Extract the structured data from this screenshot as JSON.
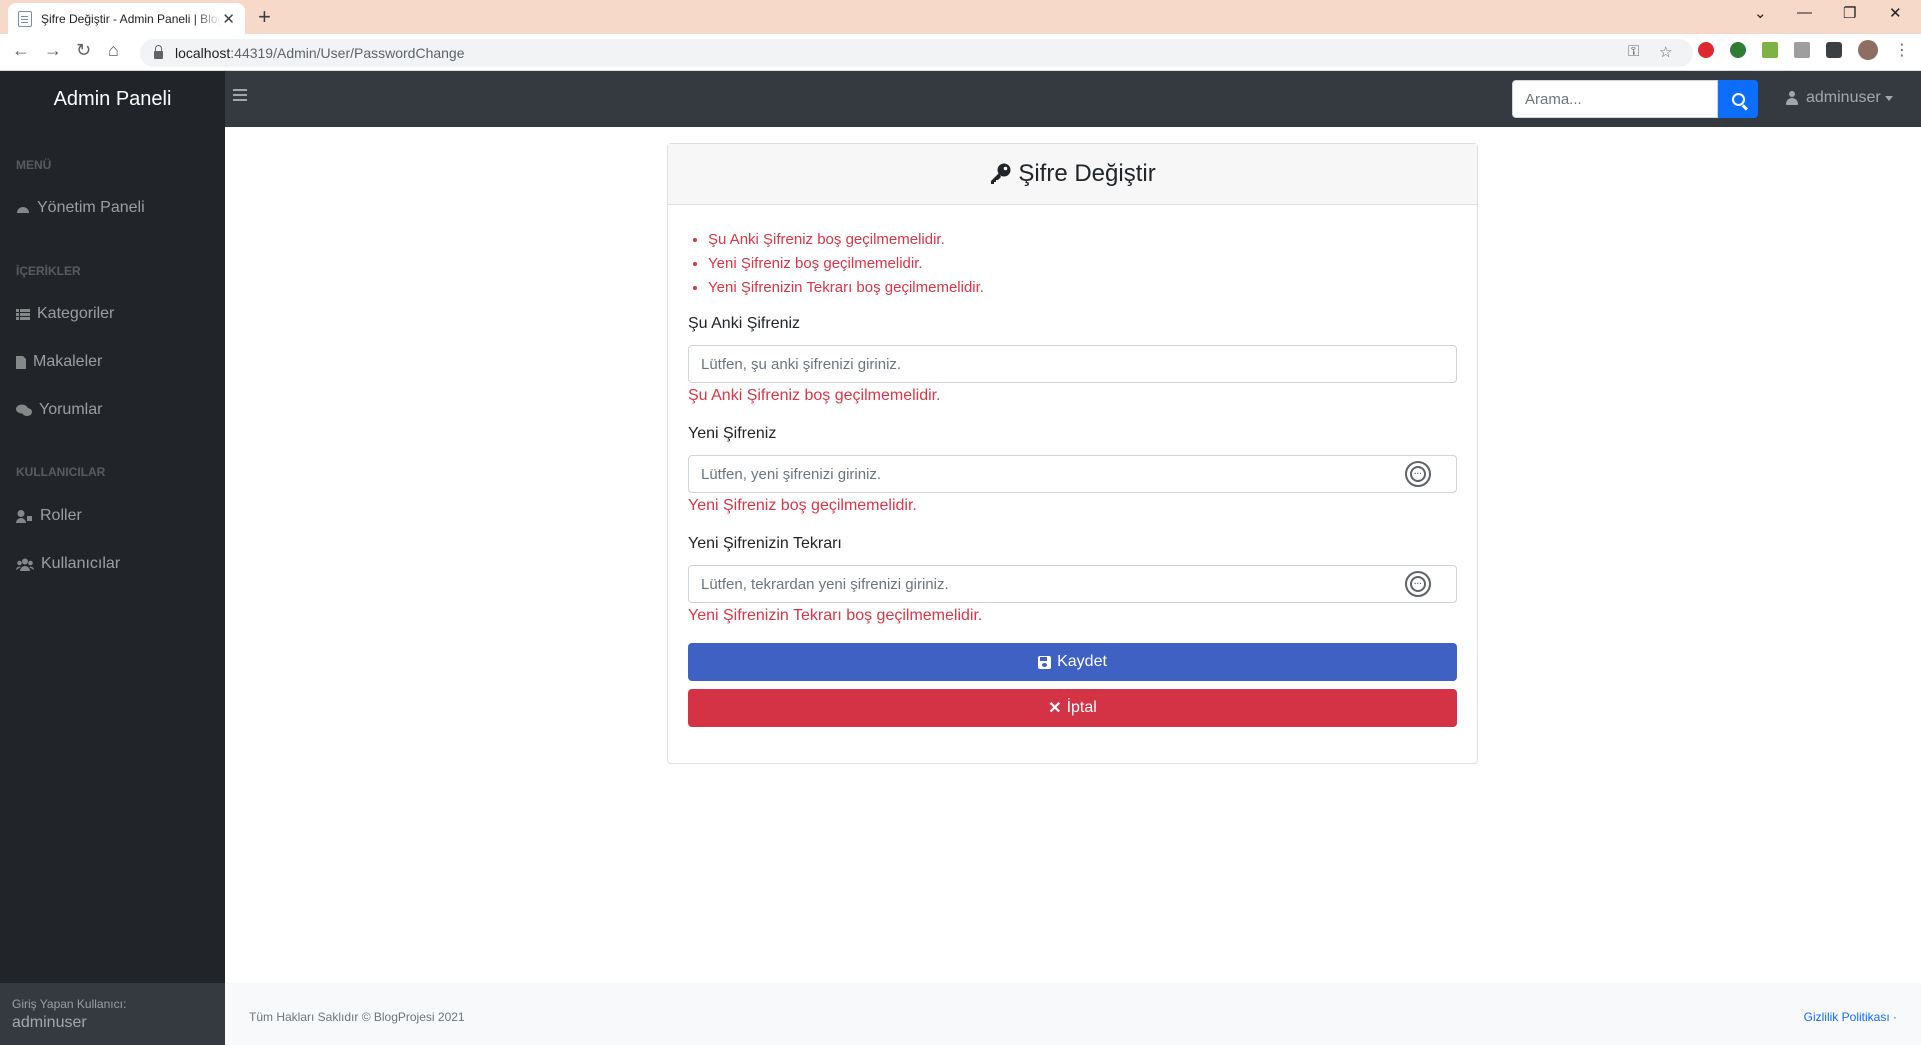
{
  "browser": {
    "tab_title": "Şifre Değiştir - Admin Paneli | BlogProjesi",
    "url_host": "localhost",
    "url_path": ":44319/Admin/User/PasswordChange"
  },
  "navbar": {
    "brand": "Admin Paneli",
    "search_placeholder": "Arama...",
    "username": "adminuser"
  },
  "sidebar": {
    "sections": [
      {
        "heading": "MENÜ",
        "items": [
          {
            "label": "Yönetim Paneli",
            "icon": "tachometer-icon"
          }
        ]
      },
      {
        "heading": "İÇERİKLER",
        "items": [
          {
            "label": "Kategoriler",
            "icon": "list-icon"
          },
          {
            "label": "Makaleler",
            "icon": "file-icon"
          },
          {
            "label": "Yorumlar",
            "icon": "comments-icon"
          }
        ]
      },
      {
        "heading": "KULLANICILAR",
        "items": [
          {
            "label": "Roller",
            "icon": "user-tag-icon"
          },
          {
            "label": "Kullanıcılar",
            "icon": "users-icon"
          }
        ]
      }
    ],
    "footer_label": "Giriş Yapan Kullanıcı:",
    "footer_user": "adminuser"
  },
  "card": {
    "title": "Şifre Değiştir",
    "errors": [
      "Şu Anki Şifreniz boş geçilmemelidir.",
      "Yeni Şifreniz boş geçilmemelidir.",
      "Yeni Şifrenizin Tekrarı boş geçilmemelidir."
    ],
    "fields": [
      {
        "label": "Şu Anki Şifreniz",
        "placeholder": "Lütfen, şu anki şifrenizi giriniz.",
        "value": "",
        "error": "Şu Anki Şifreniz boş geçilmemelidir."
      },
      {
        "label": "Yeni Şifreniz",
        "placeholder": "Lütfen, yeni şifrenizi giriniz.",
        "value": "",
        "error": "Yeni Şifreniz boş geçilmemelidir."
      },
      {
        "label": "Yeni Şifrenizin Tekrarı",
        "placeholder": "Lütfen, tekrardan yeni şifrenizi giriniz.",
        "value": "",
        "error": "Yeni Şifrenizin Tekrarı boş geçilmemelidir."
      }
    ],
    "save_label": "Kaydet",
    "cancel_label": "İptal"
  },
  "footer": {
    "copyright": "Tüm Hakları Saklıdır © BlogProjesi 2021",
    "privacy_link": "Gizlilik Politikası ·"
  },
  "colors": {
    "sidebar_bg": "#212529",
    "navbar_bg": "#343a40",
    "primary": "#4061c4",
    "danger": "#d43345",
    "error_text": "#dc3545"
  }
}
